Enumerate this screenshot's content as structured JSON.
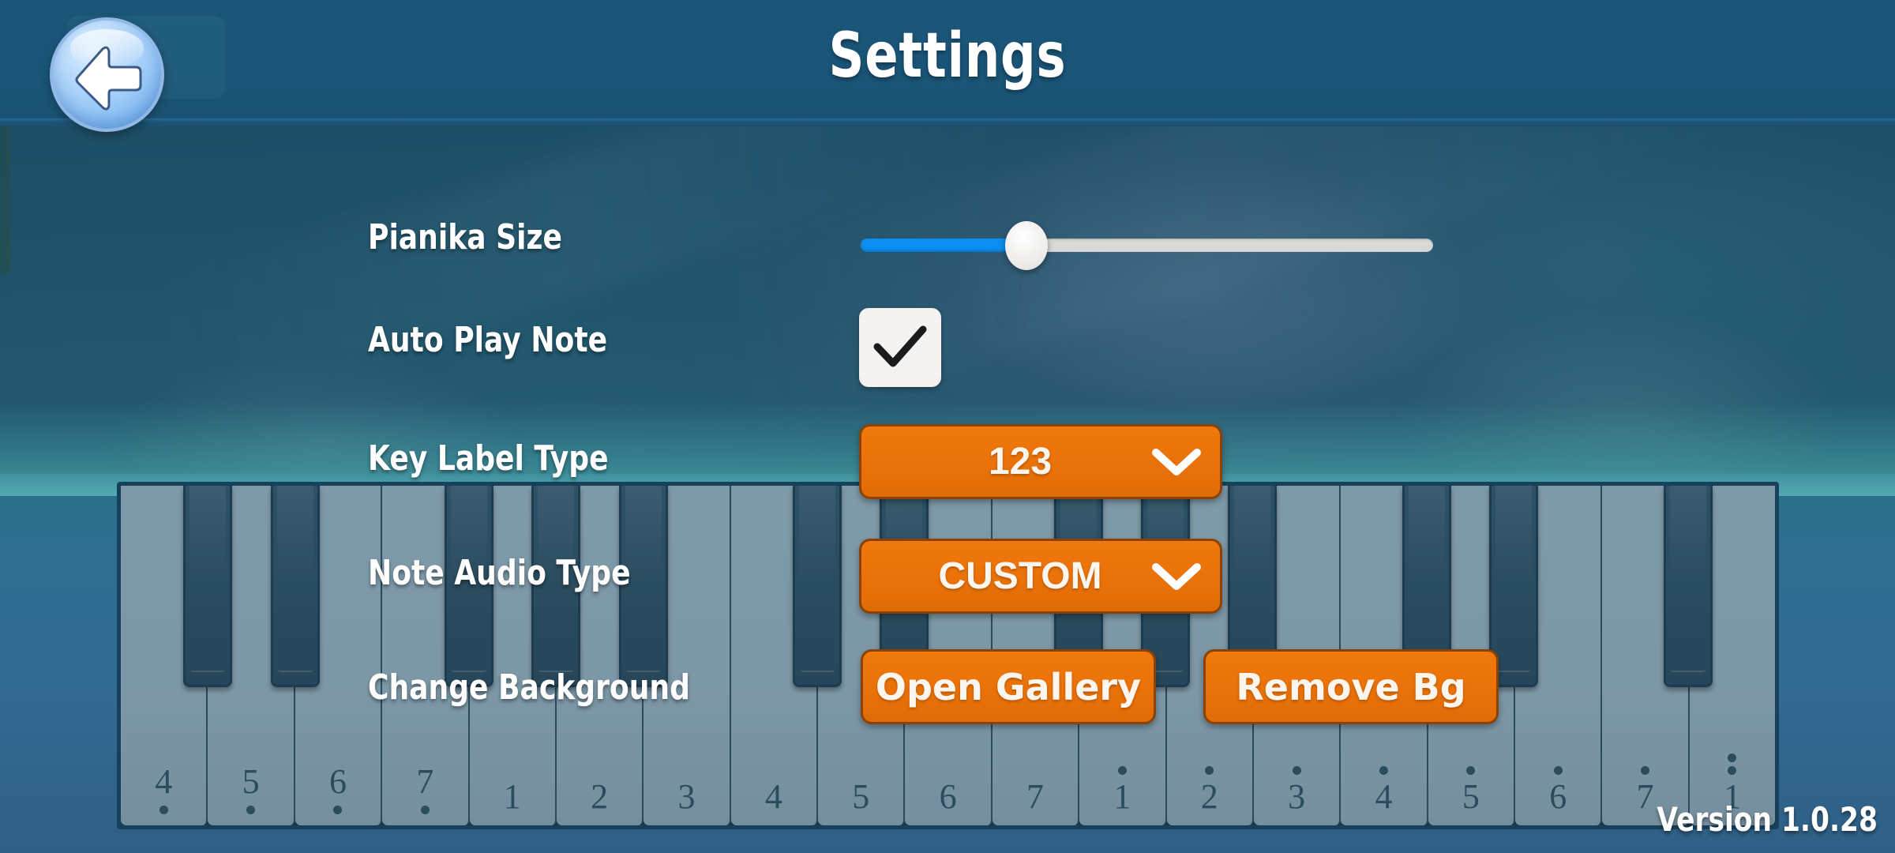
{
  "app": {
    "title": "Settings",
    "version_label": "Version 1.0.28",
    "accent_orange": "#EA7209",
    "accent_blue": "#0A8FF0",
    "topbar_bg": "#1A5578",
    "white_key_color": "#7C97A6",
    "black_key_color": "#2A4C5F"
  },
  "header": {
    "title": "Settings",
    "back_button": {
      "name": "back-button",
      "icon": "arrow-left-icon"
    }
  },
  "settings": {
    "rows": [
      {
        "id": "pianika-size",
        "label": "Pianika Size",
        "control": "slider",
        "value_percent": 29,
        "min": 0,
        "max": 100
      },
      {
        "id": "auto-play-note",
        "label": "Auto Play Note",
        "control": "checkbox",
        "checked": true,
        "icon": "check-icon"
      },
      {
        "id": "key-label-type",
        "label": "Key Label Type",
        "control": "dropdown",
        "value": "123",
        "icon": "chevron-down-icon"
      },
      {
        "id": "note-audio-type",
        "label": "Note Audio Type",
        "control": "dropdown",
        "value": "CUSTOM",
        "icon": "chevron-down-icon"
      },
      {
        "id": "change-background",
        "label": "Change Background",
        "control": "buttons",
        "buttons": [
          {
            "id": "open-gallery",
            "label": "Open Gallery"
          },
          {
            "id": "remove-bg",
            "label": "Remove Bg"
          }
        ]
      }
    ]
  },
  "piano": {
    "white_keys": [
      {
        "label": "4",
        "dots_below": 1,
        "dots_above": 0,
        "black_after": true
      },
      {
        "label": "5",
        "dots_below": 1,
        "dots_above": 0,
        "black_after": true
      },
      {
        "label": "6",
        "dots_below": 1,
        "dots_above": 0,
        "black_after": false
      },
      {
        "label": "7",
        "dots_below": 1,
        "dots_above": 0,
        "black_after": true
      },
      {
        "label": "1",
        "dots_below": 0,
        "dots_above": 0,
        "black_after": true
      },
      {
        "label": "2",
        "dots_below": 0,
        "dots_above": 0,
        "black_after": true
      },
      {
        "label": "3",
        "dots_below": 0,
        "dots_above": 0,
        "black_after": false
      },
      {
        "label": "4",
        "dots_below": 0,
        "dots_above": 0,
        "black_after": true
      },
      {
        "label": "5",
        "dots_below": 0,
        "dots_above": 0,
        "black_after": true
      },
      {
        "label": "6",
        "dots_below": 0,
        "dots_above": 0,
        "black_after": false
      },
      {
        "label": "7",
        "dots_below": 0,
        "dots_above": 0,
        "black_after": true
      },
      {
        "label": "1",
        "dots_below": 0,
        "dots_above": 1,
        "black_after": true
      },
      {
        "label": "2",
        "dots_below": 0,
        "dots_above": 1,
        "black_after": true
      },
      {
        "label": "3",
        "dots_below": 0,
        "dots_above": 1,
        "black_after": false
      },
      {
        "label": "4",
        "dots_below": 0,
        "dots_above": 1,
        "black_after": true
      },
      {
        "label": "5",
        "dots_below": 0,
        "dots_above": 1,
        "black_after": true
      },
      {
        "label": "6",
        "dots_below": 0,
        "dots_above": 1,
        "black_after": false
      },
      {
        "label": "7",
        "dots_below": 0,
        "dots_above": 1,
        "black_after": true
      },
      {
        "label": "1",
        "dots_below": 0,
        "dots_above": 2,
        "black_after": false
      }
    ]
  }
}
